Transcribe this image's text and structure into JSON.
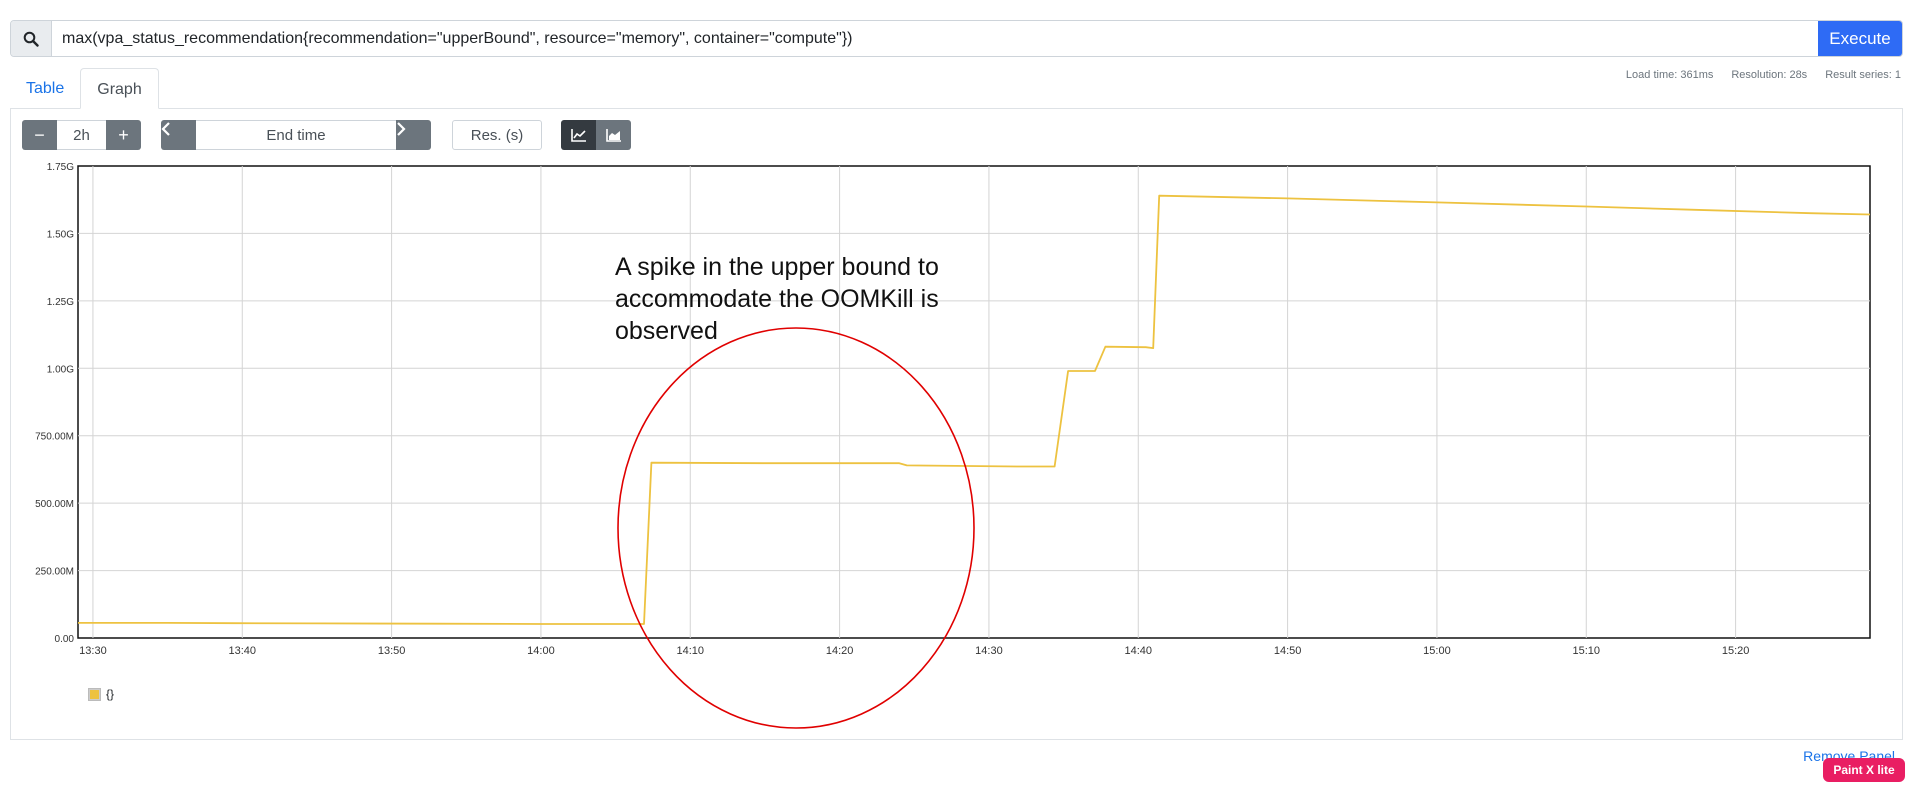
{
  "query": {
    "value": "max(vpa_status_recommendation{recommendation=\"upperBound\", resource=\"memory\", container=\"compute\"})",
    "execute_label": "Execute",
    "icon": "search-icon"
  },
  "tabs": [
    {
      "label": "Table",
      "active": false
    },
    {
      "label": "Graph",
      "active": true
    }
  ],
  "stats": {
    "load_time": "Load time: 361ms",
    "resolution": "Resolution: 28s",
    "result_series": "Result series: 1"
  },
  "controls": {
    "range_value": "2h",
    "minus_label": "−",
    "plus_label": "+",
    "end_time_label": "End time",
    "res_label": "Res. (s)"
  },
  "chart_data": {
    "type": "line",
    "xlabel": "",
    "ylabel": "",
    "x_tick_labels": [
      "13:30",
      "13:40",
      "13:50",
      "14:00",
      "14:10",
      "14:20",
      "14:30",
      "14:40",
      "14:50",
      "15:00",
      "15:10",
      "15:20"
    ],
    "y_tick_labels": [
      "0.00",
      "250.00M",
      "500.00M",
      "750.00M",
      "1.00G",
      "1.25G",
      "1.50G",
      "1.75G"
    ],
    "ylim_mb": [
      0,
      1750
    ],
    "xlim_min": [
      809,
      929
    ],
    "grid": true,
    "legend_placement": "bottom-left",
    "series": [
      {
        "name": "{}",
        "color": "#edc240",
        "points_min_mb": [
          [
            809,
            56
          ],
          [
            815,
            56
          ],
          [
            819.5,
            55
          ],
          [
            825,
            54
          ],
          [
            833,
            53
          ],
          [
            840,
            52
          ],
          [
            846.9,
            52
          ],
          [
            847.4,
            650
          ],
          [
            855,
            648
          ],
          [
            864,
            648
          ],
          [
            864.5,
            640
          ],
          [
            872,
            636
          ],
          [
            874.4,
            636
          ],
          [
            875.3,
            990
          ],
          [
            877.1,
            990
          ],
          [
            877.8,
            1080
          ],
          [
            880.5,
            1078
          ],
          [
            881,
            1075
          ],
          [
            881.4,
            1640
          ],
          [
            883,
            1638
          ],
          [
            890,
            1630
          ],
          [
            900,
            1615
          ],
          [
            910,
            1600
          ],
          [
            917,
            1588
          ],
          [
            925,
            1575
          ],
          [
            929,
            1570
          ]
        ]
      }
    ],
    "annotation": {
      "text_lines": [
        "A spike in the upper bound to",
        "accommodate the OOMKill is",
        "observed"
      ],
      "highlight_color": "#e00000"
    }
  },
  "legend": {
    "label": "{}"
  },
  "footer": {
    "remove_panel": "Remove Panel",
    "badge": "Paint X lite"
  }
}
